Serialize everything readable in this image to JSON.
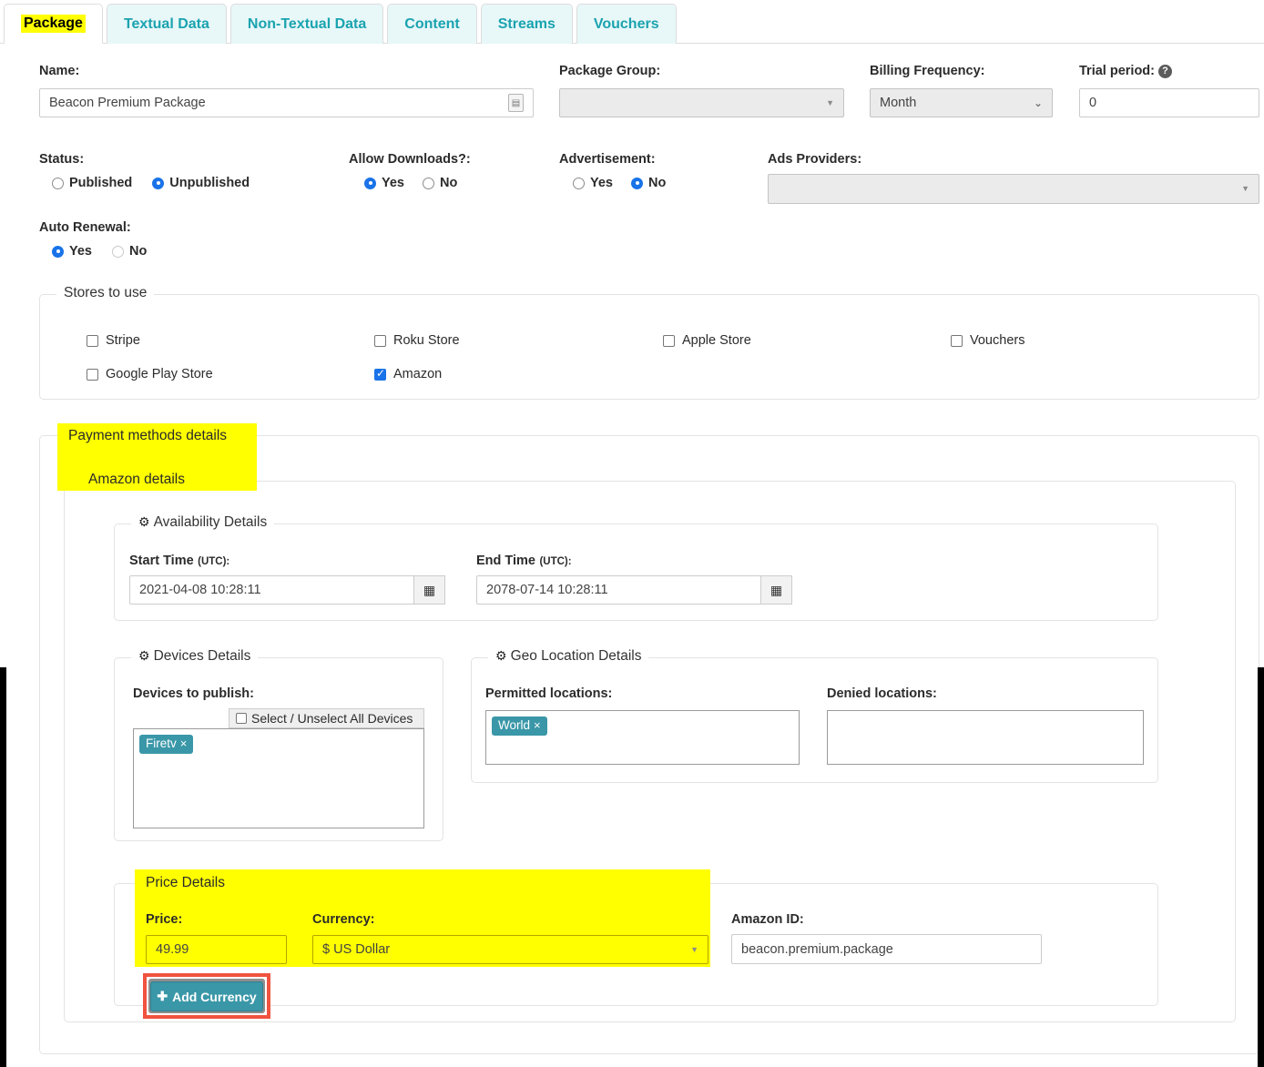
{
  "tabs": [
    {
      "label": "Package",
      "active": true
    },
    {
      "label": "Textual Data",
      "active": false
    },
    {
      "label": "Non-Textual Data",
      "active": false
    },
    {
      "label": "Content",
      "active": false
    },
    {
      "label": "Streams",
      "active": false
    },
    {
      "label": "Vouchers",
      "active": false
    }
  ],
  "form": {
    "name_label": "Name:",
    "name_value": "Beacon Premium Package",
    "package_group_label": "Package Group:",
    "package_group_value": "",
    "billing_frequency_label": "Billing Frequency:",
    "billing_frequency_value": "Month",
    "trial_period_label": "Trial period:",
    "trial_period_value": "0",
    "status_label": "Status:",
    "status_published": "Published",
    "status_unpublished": "Unpublished",
    "allow_downloads_label": "Allow Downloads?:",
    "allow_downloads_yes": "Yes",
    "allow_downloads_no": "No",
    "advertisement_label": "Advertisement:",
    "advertisement_yes": "Yes",
    "advertisement_no": "No",
    "ads_providers_label": "Ads Providers:",
    "ads_providers_value": "",
    "auto_renewal_label": "Auto Renewal:",
    "auto_renewal_yes": "Yes",
    "auto_renewal_no": "No"
  },
  "stores": {
    "legend": "Stores to use",
    "items": [
      {
        "label": "Stripe",
        "checked": false
      },
      {
        "label": "Roku Store",
        "checked": false
      },
      {
        "label": "Apple Store",
        "checked": false
      },
      {
        "label": "Vouchers",
        "checked": false
      },
      {
        "label": "Google Play Store",
        "checked": false
      },
      {
        "label": "Amazon",
        "checked": true
      }
    ]
  },
  "payment": {
    "legend": "Payment methods details",
    "amazon_legend": "Amazon details",
    "availability": {
      "legend": "Availability Details",
      "start_label": "Start Time",
      "start_sub": "(UTC):",
      "start_value": "2021-04-08 10:28:11",
      "end_label": "End Time",
      "end_sub": "(UTC):",
      "end_value": "2078-07-14 10:28:11"
    },
    "devices": {
      "legend": "Devices Details",
      "field_label": "Devices to publish:",
      "select_all_label": "Select / Unselect All Devices",
      "select_all_checked": false,
      "tags": [
        "Firetv"
      ]
    },
    "geo": {
      "legend": "Geo Location Details",
      "permitted_label": "Permitted locations:",
      "permitted_tags": [
        "World"
      ],
      "denied_label": "Denied locations:",
      "denied_tags": []
    },
    "price": {
      "legend": "Price Details",
      "price_label": "Price:",
      "price_value": "49.99",
      "currency_label": "Currency:",
      "currency_value": "$ US Dollar",
      "amazon_id_label": "Amazon ID:",
      "amazon_id_value": "beacon.premium.package",
      "add_currency_label": "Add Currency",
      "add_currency_icon": "plus-icon"
    }
  },
  "icons": {
    "gear": "gears-icon",
    "calendar": "calendar-icon",
    "help": "help-circle-icon",
    "translate": "translate-icon",
    "dropdown": "chevron-down-icon",
    "close_tag": "close-icon"
  },
  "colors": {
    "highlight": "#ffff00",
    "teal": "#3a97a8",
    "tab_text": "#1aa3b0",
    "tab_bg": "#e8f7f8",
    "radio_blue": "#1a73e8",
    "red_outline": "#f0533f"
  }
}
